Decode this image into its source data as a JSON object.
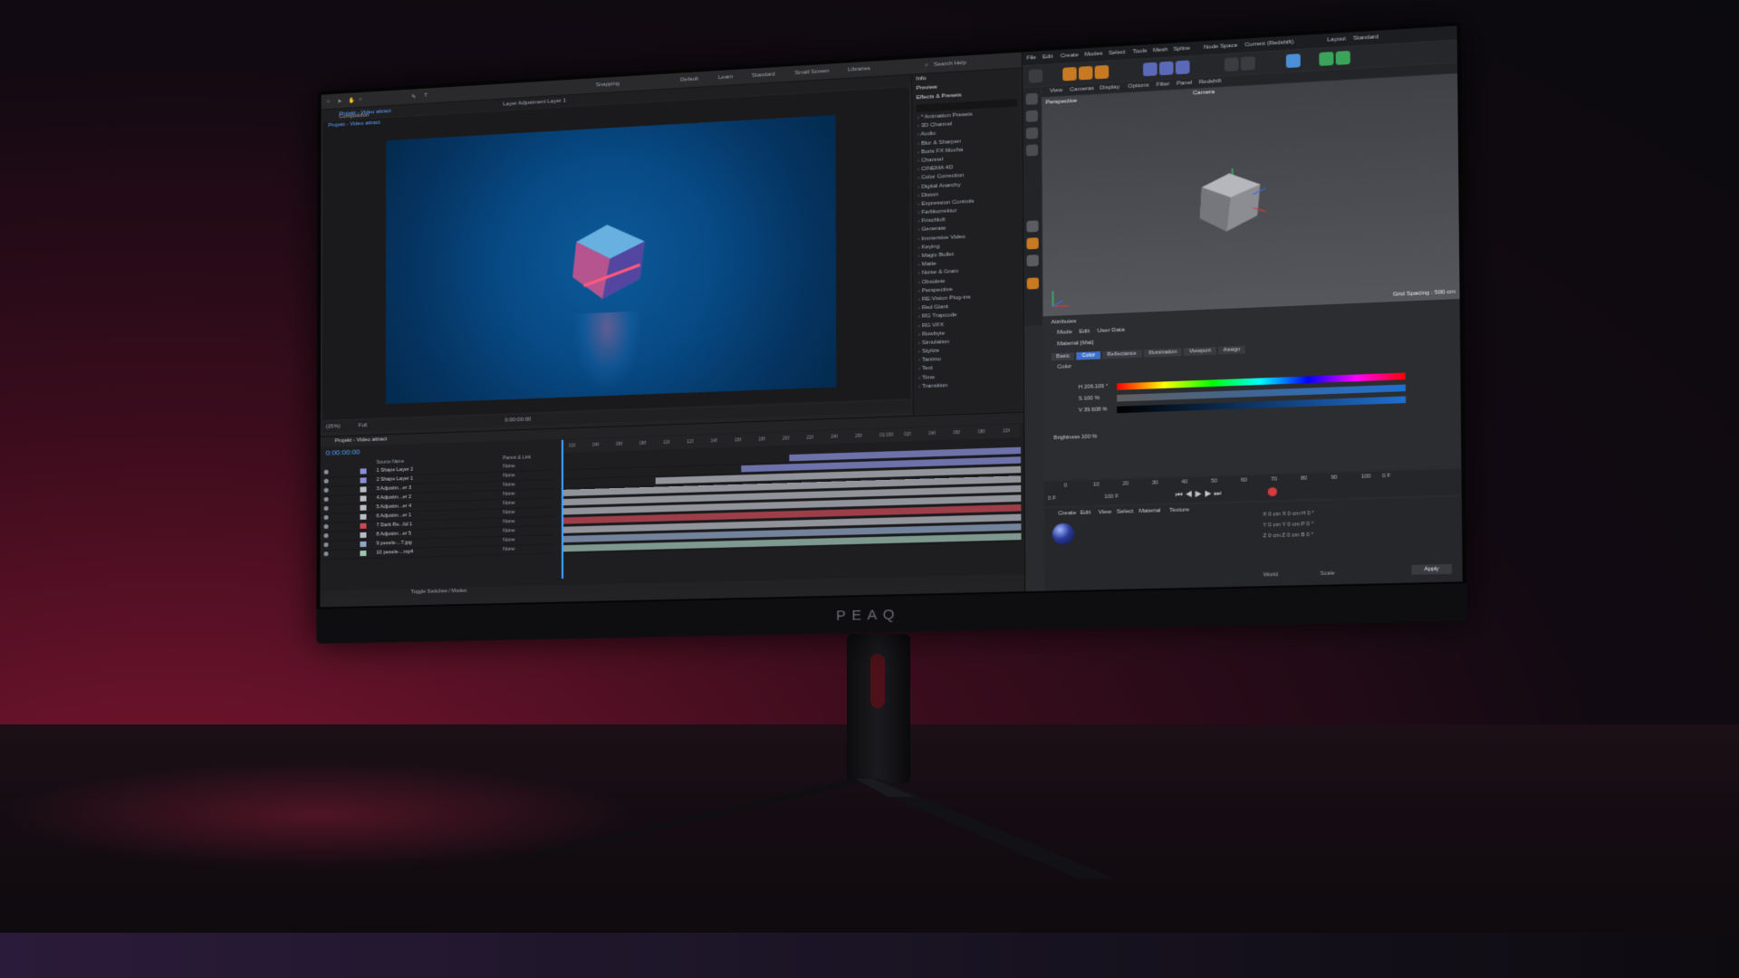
{
  "brand": "PEAQ",
  "ae": {
    "toolbar": {
      "snapping": "Snapping",
      "workspaces": [
        "Default",
        "Learn",
        "Standard",
        "Small Screen",
        "Libraries"
      ],
      "search": "Search Help"
    },
    "comp_tab": "Composition",
    "comp_name": "Projekt - Video attract",
    "layer_tab": "Layer Adjustment Layer 1",
    "comp_sub": "Projekt - Video attract",
    "viewer_zoom": "(25%)",
    "viewer_res": "Full",
    "viewer_time": "0:00:00:00",
    "effects": {
      "info": "Info",
      "preview": "Preview",
      "title": "Effects & Presets",
      "items": [
        "* Animation Presets",
        "3D Channel",
        "Audio",
        "Blur & Sharpen",
        "Boris FX Mocha",
        "Channel",
        "CINEMA 4D",
        "Color Correction",
        "Digital Anarchy",
        "Distort",
        "Expression Controls",
        "Farbkorrektur",
        "Frischluft",
        "Generate",
        "Immersive Video",
        "Keying",
        "Magic Bullet",
        "Matte",
        "Noise & Grain",
        "Obsolete",
        "Perspective",
        "RE:Vision Plug-ins",
        "Red Giant",
        "RG Trapcode",
        "RG VFX",
        "Rowbyte",
        "Simulation",
        "Stylize",
        "Tanimo",
        "Text",
        "Time",
        "Transition"
      ]
    },
    "timeline": {
      "tab": "Projekt - Video attract",
      "timecode": "0:00:00:00",
      "col_source": "Source Name",
      "col_parent": "Parent & Link",
      "ruler": [
        "01f",
        "04f",
        "06f",
        "08f",
        "10f",
        "12f",
        "14f",
        "16f",
        "18f",
        "20f",
        "22f",
        "24f",
        "26f",
        "01:00f",
        "02f",
        "04f",
        "06f",
        "08f",
        "10f"
      ],
      "layers": [
        {
          "num": "1",
          "name": "Shape Layer 2",
          "mode": "None",
          "color": "#8a8fd8"
        },
        {
          "num": "2",
          "name": "Shape Layer 1",
          "mode": "None",
          "color": "#8a8fd8"
        },
        {
          "num": "3",
          "name": "Adjustm...er 3",
          "mode": "None",
          "color": "#b9bcc4"
        },
        {
          "num": "4",
          "name": "Adjustm...er 2",
          "mode": "None",
          "color": "#b9bcc4"
        },
        {
          "num": "5",
          "name": "Adjustm...er 4",
          "mode": "None",
          "color": "#b9bcc4"
        },
        {
          "num": "6",
          "name": "Adjustm...er 1",
          "mode": "None",
          "color": "#b9bcc4"
        },
        {
          "num": "7",
          "name": "Dark Re...lid 1",
          "mode": "None",
          "color": "#c94a55"
        },
        {
          "num": "8",
          "name": "Adjustm...er 5",
          "mode": "None",
          "color": "#b9bcc4"
        },
        {
          "num": "9",
          "name": "pexels-...7.jpg",
          "mode": "None",
          "color": "#8fa6c4"
        },
        {
          "num": "10",
          "name": "pexels-...mp4",
          "mode": "None",
          "color": "#9fc3b4"
        }
      ],
      "footer": "Toggle Switches / Modes"
    }
  },
  "c4d": {
    "menu": [
      "File",
      "Edit",
      "Create",
      "Modes",
      "Select",
      "Tools",
      "Mesh",
      "Spline"
    ],
    "node_space_label": "Node Space",
    "node_space_value": "Current (Redshift)",
    "layout_label": "Layout",
    "layout_value": "Standard",
    "viewport_menu": [
      "View",
      "Cameras",
      "Display",
      "Options",
      "Filter",
      "Panel",
      "Redshift"
    ],
    "viewport_name": "Perspective",
    "camera": "Camera",
    "grid_spacing": "Grid Spacing : 500 cm",
    "attributes": {
      "title": "Attributes",
      "menu": [
        "Mode",
        "Edit",
        "User Data"
      ],
      "material": "Material [Mat]",
      "tabs": [
        "Basic",
        "Color",
        "Reflectance",
        "Illumination",
        "Viewport",
        "Assign"
      ],
      "section": "Color",
      "h_label": "H",
      "h_value": "206.109 °",
      "s_label": "S",
      "s_value": "100 %",
      "v_label": "V",
      "v_value": "39.608 %",
      "brightness_label": "Brightness",
      "brightness_value": "100 %"
    },
    "transport": {
      "ticks": [
        "0",
        "10",
        "20",
        "30",
        "40",
        "50",
        "60",
        "70",
        "80",
        "90",
        "100"
      ],
      "start": "0 F",
      "end": "100 F",
      "current": "0 F"
    },
    "material_menu": [
      "Create",
      "Edit",
      "View",
      "Select",
      "Material",
      "Texture"
    ],
    "coords": {
      "rows": [
        [
          "X",
          "0 cm",
          "X",
          "0 cm",
          "H",
          "0 °"
        ],
        [
          "Y",
          "0 cm",
          "Y",
          "0 cm",
          "P",
          "0 °"
        ],
        [
          "Z",
          "0 cm",
          "Z",
          "0 cm",
          "B",
          "0 °"
        ]
      ],
      "mode1": "World",
      "mode2": "Scale",
      "apply": "Apply"
    }
  },
  "colors": {
    "ae_accent": "#3fa3ff",
    "c4d_accent": "#3d6fc8",
    "ambient_red": "#7a1530"
  }
}
